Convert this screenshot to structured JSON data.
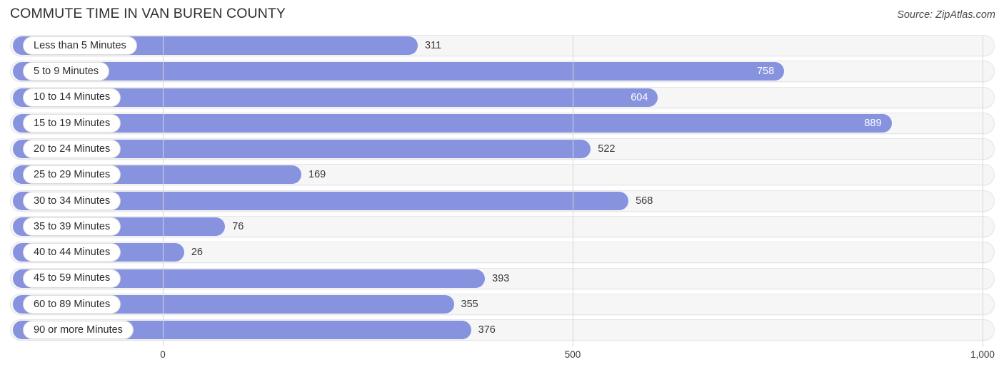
{
  "header": {
    "title": "COMMUTE TIME IN VAN BUREN COUNTY",
    "source": "Source: ZipAtlas.com"
  },
  "axis": {
    "ticks": [
      "0",
      "500",
      "1,000"
    ],
    "tick_values": [
      0,
      500,
      1000
    ]
  },
  "colors": {
    "bar": "#8793de",
    "track": "#f6f6f7",
    "value_inside": "#ffffff",
    "value_outside": "#3a3a3a",
    "gridline": "#d6d6d6",
    "title": "#2e3033"
  },
  "chart_data": {
    "type": "bar",
    "orientation": "horizontal",
    "title": "COMMUTE TIME IN VAN BUREN COUNTY",
    "subtitle": "",
    "xlabel": "",
    "ylabel": "",
    "xlim": [
      0,
      1000
    ],
    "grid": true,
    "legend": null,
    "source": "Source: ZipAtlas.com",
    "categories": [
      "Less than 5 Minutes",
      "5 to 9 Minutes",
      "10 to 14 Minutes",
      "15 to 19 Minutes",
      "20 to 24 Minutes",
      "25 to 29 Minutes",
      "30 to 34 Minutes",
      "35 to 39 Minutes",
      "40 to 44 Minutes",
      "45 to 59 Minutes",
      "60 to 89 Minutes",
      "90 or more Minutes"
    ],
    "values": [
      311,
      758,
      604,
      889,
      522,
      169,
      568,
      76,
      26,
      393,
      355,
      376
    ],
    "value_labels": [
      "311",
      "758",
      "604",
      "889",
      "522",
      "169",
      "568",
      "76",
      "26",
      "393",
      "355",
      "376"
    ],
    "label_placement": [
      "outside",
      "inside",
      "inside",
      "inside",
      "outside",
      "outside",
      "outside",
      "outside",
      "outside",
      "outside",
      "outside",
      "outside"
    ],
    "xticks": [
      0,
      500,
      1000
    ],
    "xticklabels": [
      "0",
      "500",
      "1,000"
    ]
  }
}
